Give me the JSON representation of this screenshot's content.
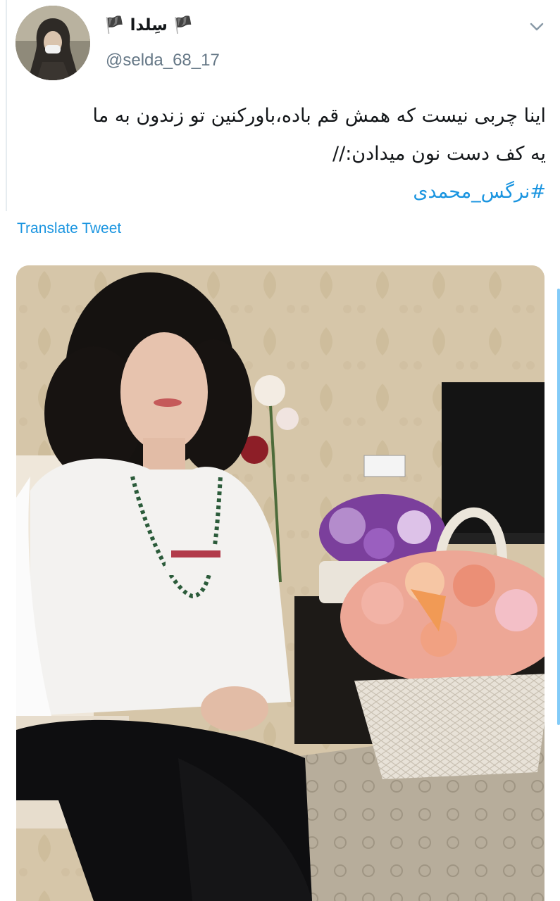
{
  "tweet": {
    "display_name": "🏴 سِلدا 🏴",
    "handle": "@selda_68_17",
    "text_lines": [
      "اینا چربی نیست که همش قم باده،باورکنین تو زندون به ما",
      "یه کف دست نون میدادن://"
    ],
    "hashtag": "#نرگس_محمدی",
    "translate_label": "Translate Tweet",
    "menu_icon": "chevron-down-icon",
    "avatar_icon": "avatar-photo",
    "media_icon": "photo"
  },
  "colors": {
    "link": "#1b95e0",
    "text": "#14171a",
    "secondary": "#657786"
  }
}
